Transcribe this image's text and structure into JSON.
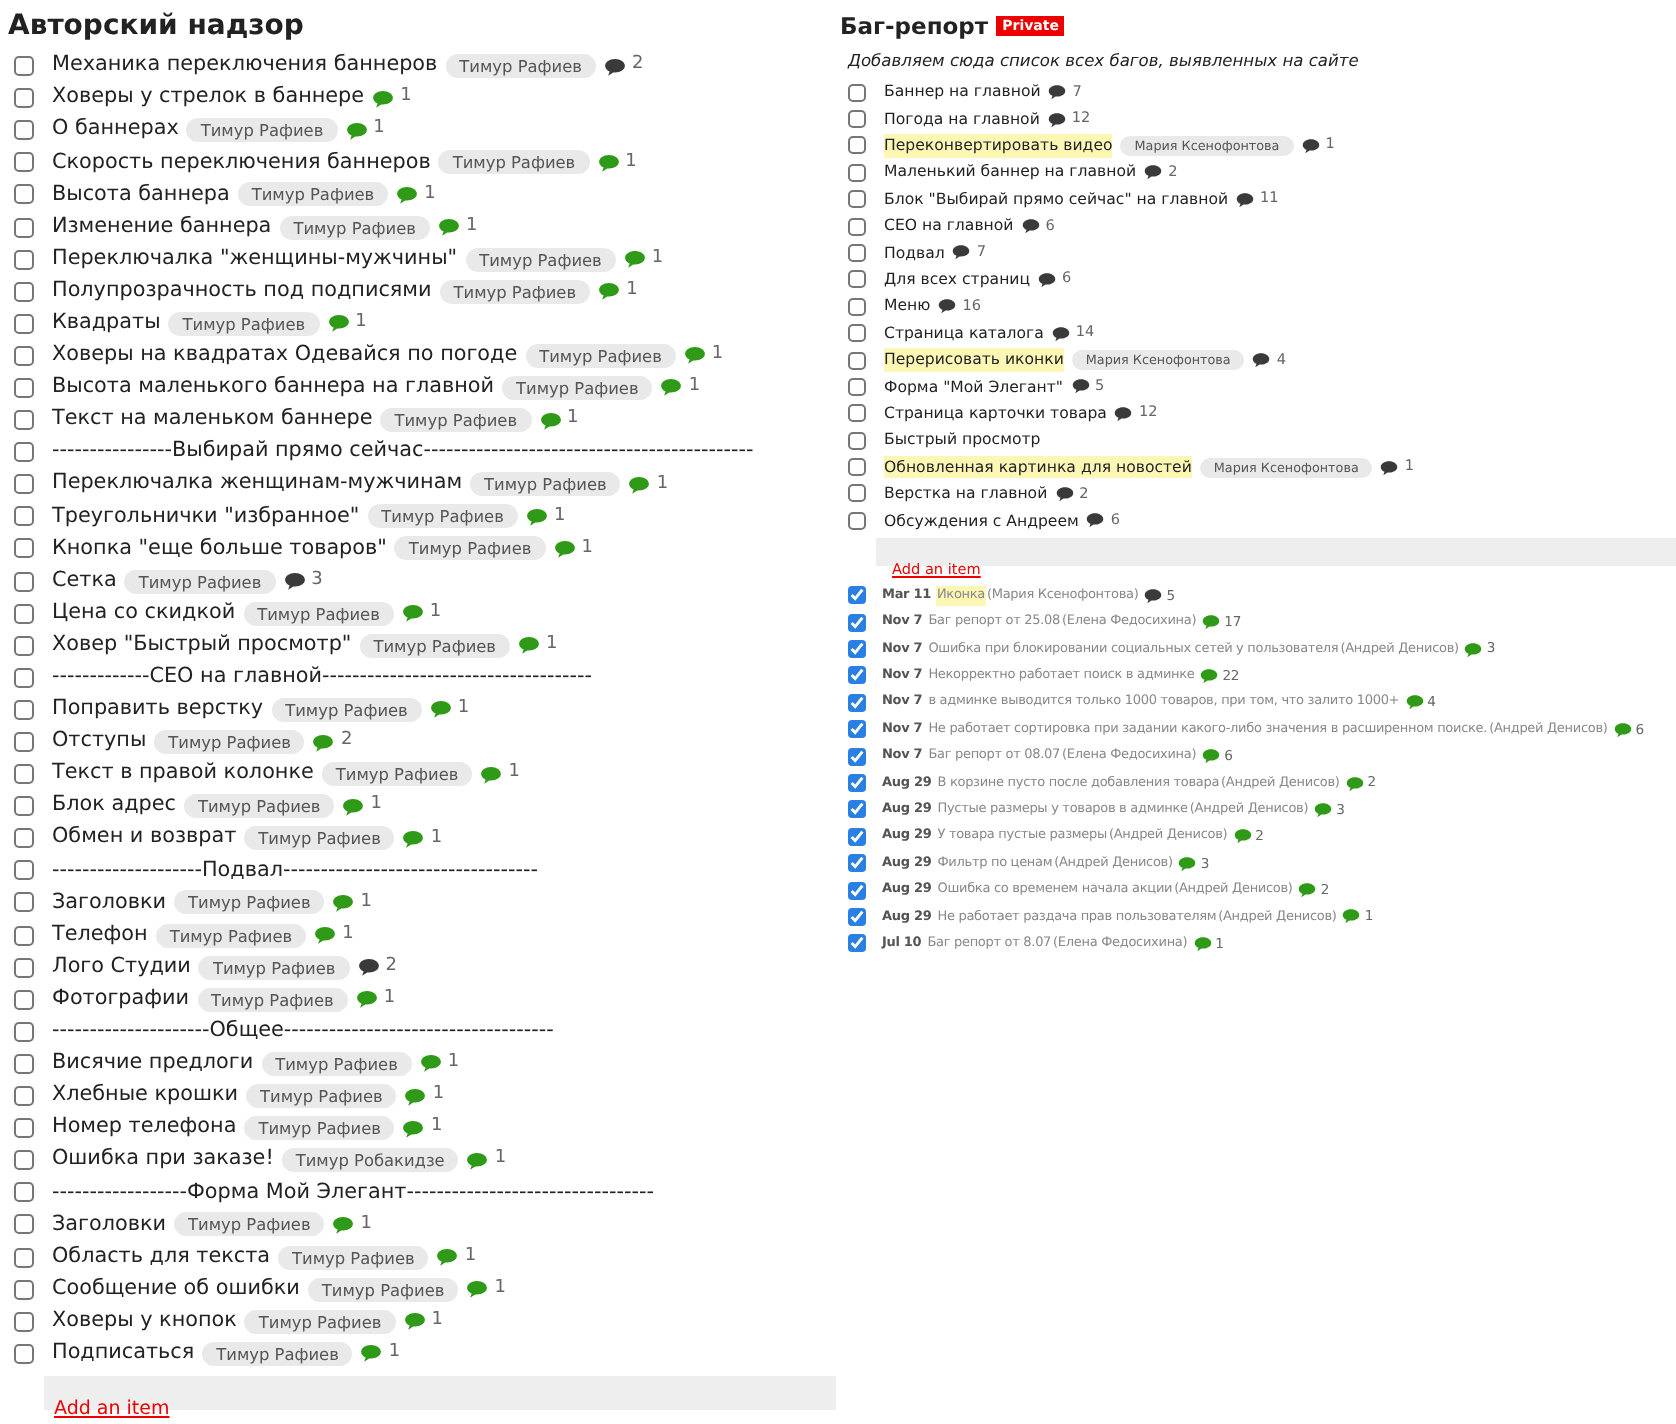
{
  "lists": [
    {
      "title": "Авторский надзор",
      "items": [
        {
          "checked": false,
          "text": "Механика переключения баннеров",
          "assignee": "Тимур Рафиев",
          "comments": "2",
          "unread": false
        },
        {
          "checked": false,
          "text": "Ховеры у стрелок в баннере",
          "comments": "1",
          "unread": true
        },
        {
          "checked": false,
          "text": "О баннерах",
          "assignee": "Тимур Рафиев",
          "comments": "1",
          "unread": true
        },
        {
          "checked": false,
          "text": "Скорость переключения баннеров",
          "assignee": "Тимур Рафиев",
          "comments": "1",
          "unread": true
        },
        {
          "checked": false,
          "text": "Высота баннера",
          "assignee": "Тимур Рафиев",
          "comments": "1",
          "unread": true
        },
        {
          "checked": false,
          "text": "Изменение баннера",
          "assignee": "Тимур Рафиев",
          "comments": "1",
          "unread": true
        },
        {
          "checked": false,
          "text": "Переключалка \"женщины-мужчины\"",
          "assignee": "Тимур Рафиев",
          "comments": "1",
          "unread": true
        },
        {
          "checked": false,
          "text": "Полупрозрачность под подписями",
          "assignee": "Тимур Рафиев",
          "comments": "1",
          "unread": true
        },
        {
          "checked": false,
          "text": "Квадраты",
          "assignee": "Тимур Рафиев",
          "comments": "1",
          "unread": true
        },
        {
          "checked": false,
          "text": "Ховеры на квадратах Одевайся по погоде",
          "assignee": "Тимур Рафиев",
          "comments": "1",
          "unread": true
        },
        {
          "checked": false,
          "text": "Высота маленького баннера на главной",
          "assignee": "Тимур Рафиев",
          "comments": "1",
          "unread": true
        },
        {
          "checked": false,
          "text": "Текст на маленьком баннере",
          "assignee": "Тимур Рафиев",
          "comments": "1",
          "unread": true
        },
        {
          "checked": false,
          "text": "----------------Выбирай прямо сейчас--------------------------------------------"
        },
        {
          "checked": false,
          "text": "Переключалка женщинам-мужчинам",
          "assignee": "Тимур Рафиев",
          "comments": "1",
          "unread": true
        },
        {
          "checked": false,
          "text": "Треугольнички \"избранное\"",
          "assignee": "Тимур Рафиев",
          "comments": "1",
          "unread": true
        },
        {
          "checked": false,
          "text": "Кнопка \"еще больше товаров\"",
          "assignee": "Тимур Рафиев",
          "comments": "1",
          "unread": true
        },
        {
          "checked": false,
          "text": "Сетка",
          "assignee": "Тимур Рафиев",
          "comments": "3",
          "unread": false
        },
        {
          "checked": false,
          "text": "Цена со скидкой",
          "assignee": "Тимур Рафиев",
          "comments": "1",
          "unread": true
        },
        {
          "checked": false,
          "text": "Ховер \"Быстрый просмотр\"",
          "assignee": "Тимур Рафиев",
          "comments": "1",
          "unread": true
        },
        {
          "checked": false,
          "text": "-------------СЕО на главной------------------------------------"
        },
        {
          "checked": false,
          "text": "Поправить верстку",
          "assignee": "Тимур Рафиев",
          "comments": "1",
          "unread": true
        },
        {
          "checked": false,
          "text": "Отступы",
          "assignee": "Тимур Рафиев",
          "comments": "2",
          "unread": true
        },
        {
          "checked": false,
          "text": "Текст в правой колонке",
          "assignee": "Тимур Рафиев",
          "comments": "1",
          "unread": true
        },
        {
          "checked": false,
          "text": "Блок адрес",
          "assignee": "Тимур Рафиев",
          "comments": "1",
          "unread": true
        },
        {
          "checked": false,
          "text": "Обмен и возврат",
          "assignee": "Тимур Рафиев",
          "comments": "1",
          "unread": true
        },
        {
          "checked": false,
          "text": "--------------------Подвал----------------------------------"
        },
        {
          "checked": false,
          "text": "Заголовки",
          "assignee": "Тимур Рафиев",
          "comments": "1",
          "unread": true
        },
        {
          "checked": false,
          "text": "Телефон",
          "assignee": "Тимур Рафиев",
          "comments": "1",
          "unread": true
        },
        {
          "checked": false,
          "text": "Лого Студии",
          "assignee": "Тимур Рафиев",
          "comments": "2",
          "unread": false
        },
        {
          "checked": false,
          "text": "Фотографии",
          "assignee": "Тимур Рафиев",
          "comments": "1",
          "unread": true
        },
        {
          "checked": false,
          "text": "---------------------Общее------------------------------------"
        },
        {
          "checked": false,
          "text": "Висячие предлоги",
          "assignee": "Тимур Рафиев",
          "comments": "1",
          "unread": true
        },
        {
          "checked": false,
          "text": "Хлебные крошки",
          "assignee": "Тимур Рафиев",
          "comments": "1",
          "unread": true
        },
        {
          "checked": false,
          "text": "Номер телефона",
          "assignee": "Тимур Рафиев",
          "comments": "1",
          "unread": true
        },
        {
          "checked": false,
          "text": "Ошибка при заказе!",
          "assignee": "Тимур Робакидзе",
          "comments": "1",
          "unread": true
        },
        {
          "checked": false,
          "text": "------------------Форма Мой Элегант---------------------------------"
        },
        {
          "checked": false,
          "text": "Заголовки",
          "assignee": "Тимур Рафиев",
          "comments": "1",
          "unread": true
        },
        {
          "checked": false,
          "text": "Область для текста",
          "assignee": "Тимур Рафиев",
          "comments": "1",
          "unread": true
        },
        {
          "checked": false,
          "text": "Сообщение об ошибки",
          "assignee": "Тимур Рафиев",
          "comments": "1",
          "unread": true
        },
        {
          "checked": false,
          "text": "Ховеры у кнопок",
          "assignee": "Тимур Рафиев",
          "comments": "1",
          "unread": true
        },
        {
          "checked": false,
          "text": "Подписаться",
          "assignee": "Тимур Рафиев",
          "comments": "1",
          "unread": true
        }
      ],
      "add_link": "Add an item"
    },
    {
      "title": "Баг-репорт",
      "badge": "Private",
      "description": "Добавляем сюда список всех багов, выявленных на сайте",
      "items": [
        {
          "checked": false,
          "text": "Баннер на главной",
          "comments": "7",
          "unread": false,
          "highlighted": false
        },
        {
          "checked": false,
          "text": "Погода на главной",
          "comments": "12",
          "unread": false,
          "highlighted": false
        },
        {
          "checked": false,
          "text": "Переконвертировать видео",
          "assignee": "Мария Ксенофонтова",
          "comments": "1",
          "unread": false,
          "highlighted": true
        },
        {
          "checked": false,
          "text": "Маленький баннер на главной",
          "comments": "2",
          "unread": false,
          "highlighted": false
        },
        {
          "checked": false,
          "text": "Блок \"Выбирай прямо сейчас\" на главной",
          "comments": "11",
          "unread": false,
          "highlighted": false
        },
        {
          "checked": false,
          "text": "СЕО на главной",
          "comments": "6",
          "unread": false,
          "highlighted": false
        },
        {
          "checked": false,
          "text": "Подвал",
          "comments": "7",
          "unread": false,
          "highlighted": false
        },
        {
          "checked": false,
          "text": "Для всех страниц",
          "comments": "6",
          "unread": false,
          "highlighted": false
        },
        {
          "checked": false,
          "text": "Меню",
          "comments": "16",
          "unread": false,
          "highlighted": false
        },
        {
          "checked": false,
          "text": "Страница каталога",
          "comments": "14",
          "unread": false,
          "highlighted": false
        },
        {
          "checked": false,
          "text": "Перерисовать иконки",
          "assignee": "Мария Ксенофонтова",
          "comments": "4",
          "unread": false,
          "highlighted": true
        },
        {
          "checked": false,
          "text": "Форма \"Мой Элегант\"",
          "comments": "5",
          "unread": false,
          "highlighted": false
        },
        {
          "checked": false,
          "text": "Страница карточки товара",
          "comments": "12",
          "unread": false,
          "highlighted": false
        },
        {
          "checked": false,
          "text": "Быстрый просмотр",
          "highlighted": false
        },
        {
          "checked": false,
          "text": "Обновленная картинка для новостей",
          "assignee": "Мария Ксенофонтова",
          "comments": "1",
          "unread": false,
          "highlighted": true
        },
        {
          "checked": false,
          "text": "Верстка на главной",
          "comments": "2",
          "unread": false,
          "highlighted": false
        },
        {
          "checked": false,
          "text": "Обсуждения с Андреем",
          "comments": "6",
          "unread": false,
          "highlighted": false
        }
      ],
      "add_link": "Add an item",
      "completed": [
        {
          "checked": true,
          "date": "Mar 11",
          "text": "Иконка",
          "by": "(Мария Ксенофонтова)",
          "highlighted": true,
          "comments": "5",
          "unread": false
        },
        {
          "checked": true,
          "date": "Nov 7",
          "text": "Баг репорт от 25.08",
          "by": "(Елена Федосихина)",
          "highlighted": false,
          "comments": "17",
          "unread": true
        },
        {
          "checked": true,
          "date": "Nov 7",
          "text": "Ошибка при блокировании социальных сетей у пользователя",
          "by": "(Андрей Денисов)",
          "highlighted": false,
          "comments": "3",
          "unread": true
        },
        {
          "checked": true,
          "date": "Nov 7",
          "text": "Некорректно работает поиск в админке",
          "highlighted": false,
          "comments": "22",
          "unread": true
        },
        {
          "checked": true,
          "date": "Nov 7",
          "text": "в админке выводится только 1000 товаров, при том, что залито 1000+",
          "highlighted": false,
          "comments": "4",
          "unread": true
        },
        {
          "checked": true,
          "date": "Nov 7",
          "text": "Не работает сортировка при задании какого-либо значения в расширенном поиске.",
          "by": "(Андрей Денисов)",
          "highlighted": false,
          "comments": "6",
          "unread": true
        },
        {
          "checked": true,
          "date": "Nov 7",
          "text": "Баг репорт от 08.07",
          "by": "(Елена Федосихина)",
          "highlighted": false,
          "comments": "6",
          "unread": true
        },
        {
          "checked": true,
          "date": "Aug 29",
          "text": "В корзине пусто после добавления товара",
          "by": "(Андрей Денисов)",
          "highlighted": false,
          "comments": "2",
          "unread": true
        },
        {
          "checked": true,
          "date": "Aug 29",
          "text": "Пустые размеры у товаров в админке",
          "by": "(Андрей Денисов)",
          "highlighted": false,
          "comments": "3",
          "unread": true
        },
        {
          "checked": true,
          "date": "Aug 29",
          "text": "У товара пустые размеры",
          "by": "(Андрей Денисов)",
          "highlighted": false,
          "comments": "2",
          "unread": true
        },
        {
          "checked": true,
          "date": "Aug 29",
          "text": "Фильтр по ценам",
          "by": "(Андрей Денисов)",
          "highlighted": false,
          "comments": "3",
          "unread": true
        },
        {
          "checked": true,
          "date": "Aug 29",
          "text": "Ошибка со временем начала акции",
          "by": "(Андрей Денисов)",
          "highlighted": false,
          "comments": "2",
          "unread": true
        },
        {
          "checked": true,
          "date": "Aug 29",
          "text": "Не работает раздача прав пользователям",
          "by": "(Андрей Денисов)",
          "highlighted": false,
          "comments": "1",
          "unread": true
        },
        {
          "checked": true,
          "date": "Jul 10",
          "text": "Баг репорт от 8.07",
          "by": "(Елена Федосихина)",
          "highlighted": false,
          "comments": "1",
          "unread": true
        }
      ]
    }
  ]
}
